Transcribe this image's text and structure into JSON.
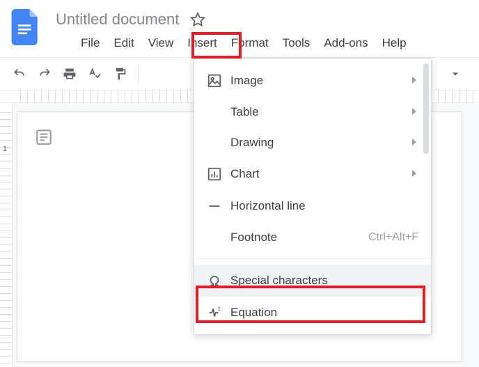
{
  "doc": {
    "title": "Untitled document"
  },
  "menu": {
    "file": "File",
    "edit": "Edit",
    "view": "View",
    "insert": "Insert",
    "format": "Format",
    "tools": "Tools",
    "addons": "Add-ons",
    "help": "Help"
  },
  "dropdown": {
    "image": "Image",
    "table": "Table",
    "drawing": "Drawing",
    "chart": "Chart",
    "hline": "Horizontal line",
    "footnote": "Footnote",
    "footnote_shortcut": "Ctrl+Alt+F",
    "special": "Special characters",
    "equation": "Equation"
  },
  "ruler": {
    "one": "1"
  }
}
